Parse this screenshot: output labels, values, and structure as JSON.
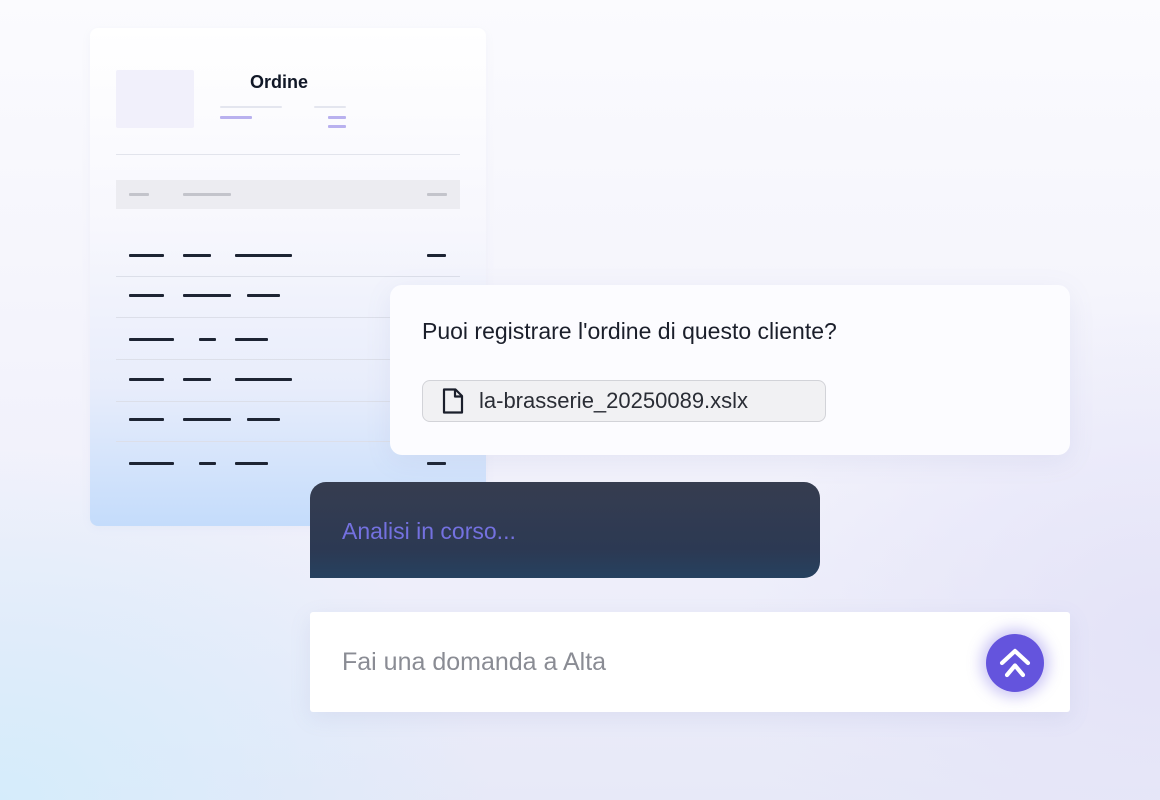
{
  "order_document": {
    "title": "Ordine",
    "row_count": 6
  },
  "user_message": {
    "text": "Puoi registrare l'ordine di questo cliente?",
    "attachment": {
      "file_name": "la-brasserie_20250089.xslx",
      "icon": "document-icon"
    }
  },
  "assistant_status": {
    "text": "Analisi in corso..."
  },
  "input": {
    "placeholder": "Fai una domanda a Alta",
    "value": ""
  },
  "send_button": {
    "icon": "alta-logo-icon"
  },
  "colors": {
    "accent": "#6454dd",
    "status_bubble": "#2f3a52",
    "status_text": "#7471e0"
  }
}
